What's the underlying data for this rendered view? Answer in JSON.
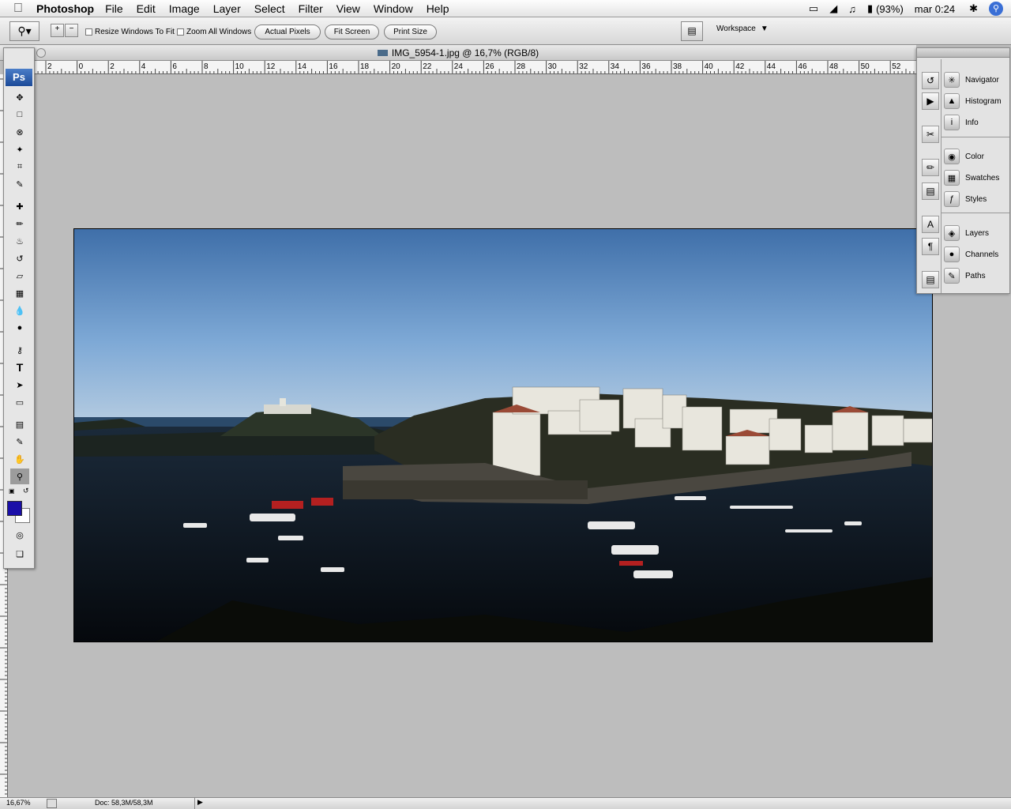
{
  "menubar": {
    "app_name": "Photoshop",
    "items": [
      "File",
      "Edit",
      "Image",
      "Layer",
      "Select",
      "Filter",
      "View",
      "Window",
      "Help"
    ],
    "battery": "(93%)",
    "clock": "mar 0:24"
  },
  "options": {
    "resize_windows": "Resize Windows To Fit",
    "zoom_all": "Zoom All Windows",
    "actual_pixels": "Actual Pixels",
    "fit_screen": "Fit Screen",
    "print_size": "Print Size",
    "workspace": "Workspace"
  },
  "document": {
    "title": "IMG_5954-1.jpg @ 16,7% (RGB/8)",
    "ruler_labels": [
      "2",
      "0",
      "2",
      "4",
      "6",
      "8",
      "10",
      "12",
      "14",
      "16",
      "18",
      "20",
      "22",
      "24",
      "26",
      "28",
      "30",
      "32",
      "34",
      "36",
      "38",
      "40",
      "42",
      "44",
      "46",
      "48",
      "50",
      "52"
    ]
  },
  "status": {
    "zoom": "16,67%",
    "doc_size": "Doc: 58,3M/58,3M"
  },
  "palettes": {
    "group1": [
      "Navigator",
      "Histogram",
      "Info"
    ],
    "group2": [
      "Color",
      "Swatches",
      "Styles"
    ],
    "group3": [
      "Layers",
      "Channels",
      "Paths"
    ]
  },
  "colors": {
    "foreground": "#1a0fa8",
    "background": "#ffffff"
  },
  "toolbox": {
    "logo": "Ps"
  }
}
